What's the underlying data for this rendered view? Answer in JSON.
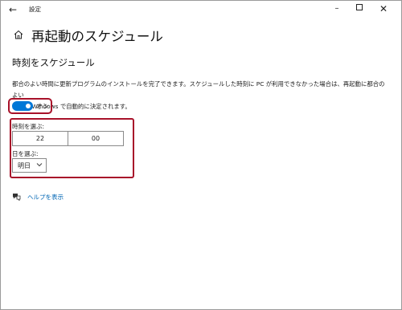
{
  "window": {
    "title": "設定",
    "back_icon": "back-arrow-icon",
    "controls": {
      "minimize": "–",
      "close": "✕"
    }
  },
  "page": {
    "title": "再起動のスケジュール",
    "icon": "home-icon"
  },
  "section": {
    "title": "時刻をスケジュール",
    "description_line1": "都合のよい時間に更新プログラムのインストールを完了できます。スケジュールした時刻に PC が利用できなかった場合は、再起動に都合のよい",
    "description_line2": "時刻が Windows で自動的に決定されます。"
  },
  "toggle": {
    "state_label": "オン",
    "on": true
  },
  "time_picker": {
    "label": "時刻を選ぶ:",
    "hour": "22",
    "minute": "00"
  },
  "day_picker": {
    "label": "日を選ぶ:",
    "selected": "明日"
  },
  "help": {
    "label": "ヘルプを表示",
    "icon": "help-chat-icon"
  },
  "colors": {
    "accent": "#0078d7",
    "highlight": "#a8122a",
    "link": "#0066b4"
  }
}
